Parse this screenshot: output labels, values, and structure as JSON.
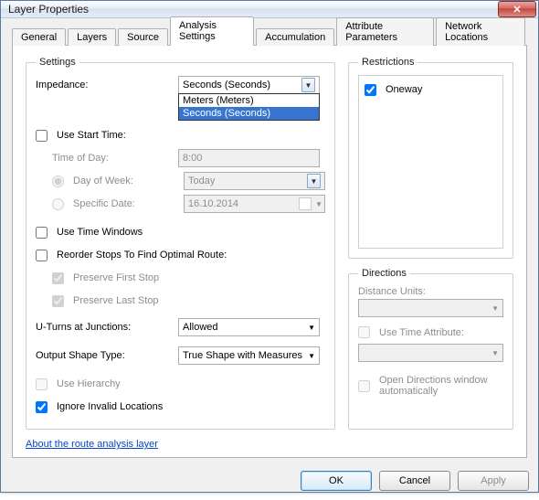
{
  "window": {
    "title": "Layer Properties"
  },
  "tabs": [
    "General",
    "Layers",
    "Source",
    "Analysis Settings",
    "Accumulation",
    "Attribute Parameters",
    "Network Locations"
  ],
  "active_tab": 3,
  "settings": {
    "legend": "Settings",
    "impedance_label": "Impedance:",
    "impedance_value": "Seconds (Seconds)",
    "impedance_options": [
      "Meters (Meters)",
      "Seconds (Seconds)"
    ],
    "impedance_selected_index": 1,
    "use_start_time": {
      "label": "Use Start Time:",
      "checked": false
    },
    "time_of_day": {
      "label": "Time of Day:",
      "value": "8:00"
    },
    "day_of_week": {
      "label": "Day of Week:",
      "selected": true,
      "value": "Today"
    },
    "specific_date": {
      "label": "Specific Date:",
      "selected": false,
      "value": "16.10.2014"
    },
    "use_time_windows": {
      "label": "Use Time Windows",
      "checked": false
    },
    "reorder": {
      "label": "Reorder Stops To Find Optimal Route:",
      "checked": false
    },
    "preserve_first": {
      "label": "Preserve First Stop",
      "checked": true
    },
    "preserve_last": {
      "label": "Preserve Last Stop",
      "checked": true
    },
    "uturns": {
      "label": "U-Turns at Junctions:",
      "value": "Allowed"
    },
    "output_shape": {
      "label": "Output Shape Type:",
      "value": "True Shape with Measures"
    },
    "use_hierarchy": {
      "label": "Use Hierarchy",
      "checked": false
    },
    "ignore_invalid": {
      "label": "Ignore Invalid Locations",
      "checked": true
    }
  },
  "restrictions": {
    "legend": "Restrictions",
    "items": [
      {
        "label": "Oneway",
        "checked": true
      }
    ]
  },
  "directions": {
    "legend": "Directions",
    "distance_units_label": "Distance Units:",
    "distance_units_value": "",
    "use_time_attr": {
      "label": "Use Time Attribute:",
      "checked": false,
      "value": ""
    },
    "open_auto": {
      "label": "Open Directions window automatically",
      "checked": false
    }
  },
  "link": "About the route analysis layer",
  "buttons": {
    "ok": "OK",
    "cancel": "Cancel",
    "apply": "Apply"
  }
}
